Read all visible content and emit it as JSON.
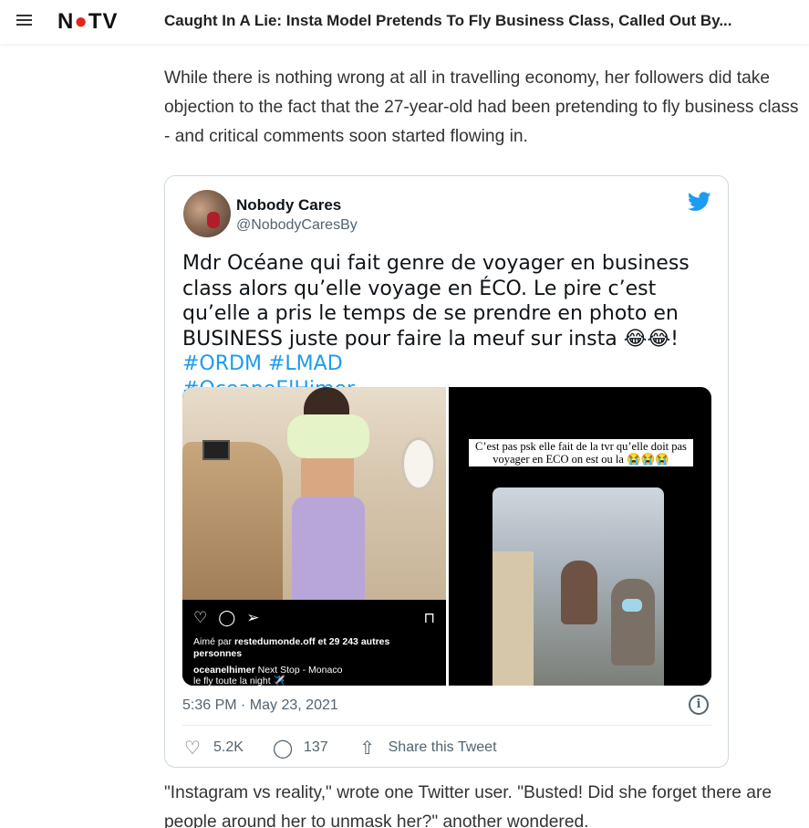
{
  "header": {
    "logo": "NDTV",
    "headline": "Caught In A Lie: Insta Model Pretends To Fly Business Class, Called Out By..."
  },
  "article": {
    "para1": "While there is nothing wrong at all in travelling economy, her followers did take objection to the fact that the 27-year-old had been pretending to fly business class - and critical comments soon started flowing in.",
    "para2": "\"Instagram vs reality,\" wrote one Twitter user. \"Busted! Did she forget there are people around her to unmask her?\" another wondered."
  },
  "tweet": {
    "author_name": "Nobody Cares",
    "author_handle": "@NobodyCaresBy",
    "text_body": "Mdr Océane qui fait genre de voyager en business class alors qu’elle voyage en ÉCO. Le pire c’est qu’elle a pris le temps de se prendre en photo en BUSINESS juste pour faire la meuf sur insta ",
    "emoji": "😂😂",
    "exclaim": "! ",
    "hashtags": [
      "#ORDM",
      "#LMAD",
      "#OceaneElHimer"
    ],
    "media": {
      "ig_likes_prefix": "Aimé par ",
      "ig_likes_user": "restedumonde.off",
      "ig_likes_suffix": " et 29 243 autres personnes",
      "ig_caption_user": "oceanelhimer",
      "ig_caption_text": " Next Stop - Monaco",
      "ig_caption_line2": "le fly toute la night ✈️",
      "story_caption": "C’est pas psk elle fait de la tvr qu’elle doit pas voyager en ECO on est ou la 😭😭😭"
    },
    "timestamp": "5:36 PM · May 23, 2021",
    "likes": "5.2K",
    "replies": "137",
    "share_label": "Share this Tweet"
  },
  "colors": {
    "link_blue": "#1d9bf0",
    "twitter_blue": "#1d9bf0",
    "ndtv_red": "#e1261c"
  }
}
